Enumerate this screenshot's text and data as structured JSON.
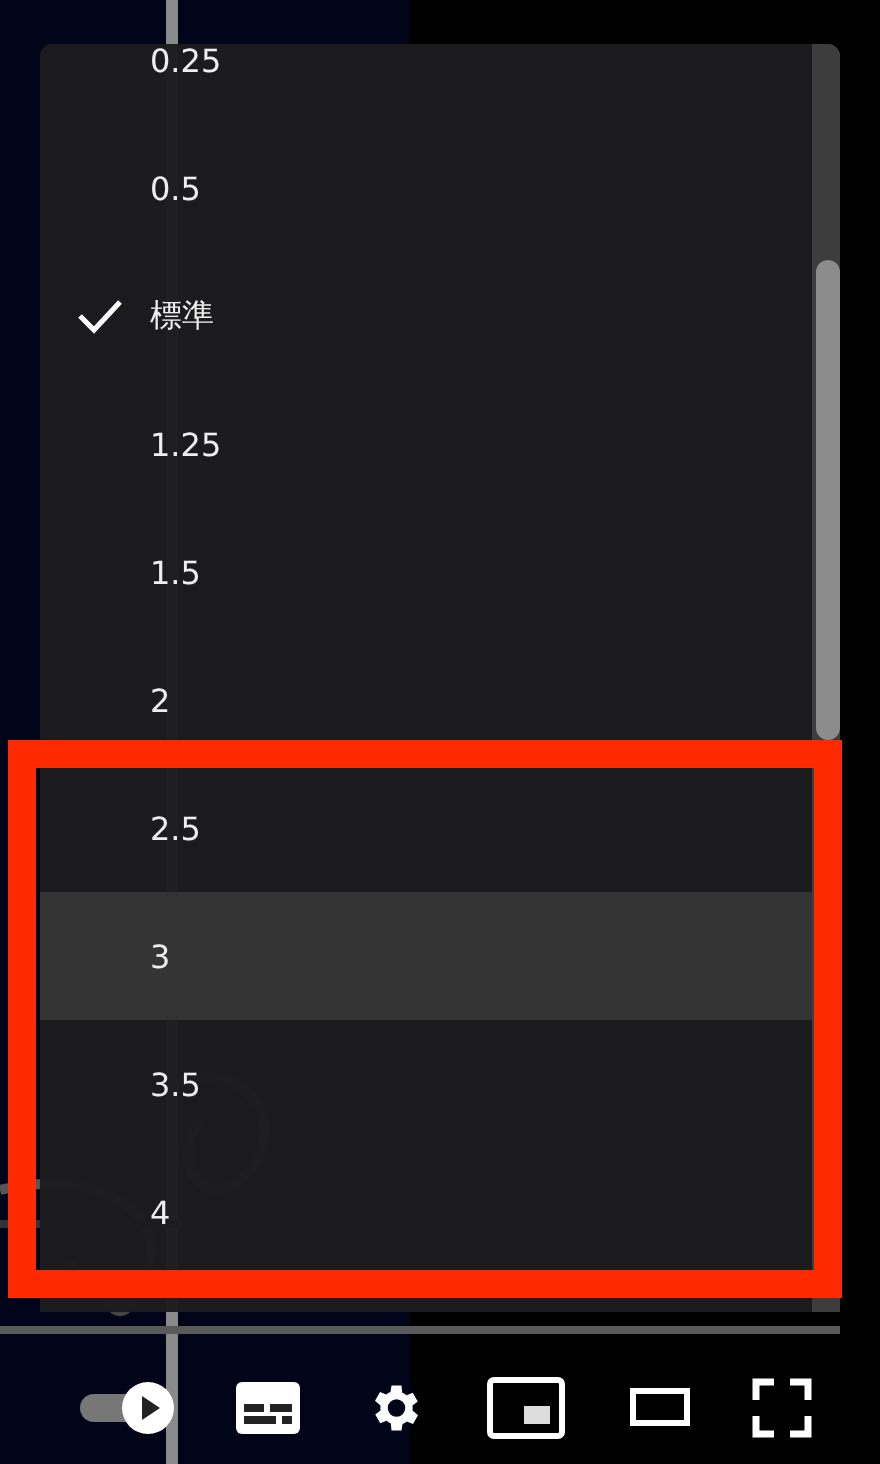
{
  "speed_menu": {
    "items": [
      {
        "label": "0.25",
        "selected": false,
        "hovered": false
      },
      {
        "label": "0.5",
        "selected": false,
        "hovered": false
      },
      {
        "label": "標準",
        "selected": true,
        "hovered": false
      },
      {
        "label": "1.25",
        "selected": false,
        "hovered": false
      },
      {
        "label": "1.5",
        "selected": false,
        "hovered": false
      },
      {
        "label": "2",
        "selected": false,
        "hovered": false
      },
      {
        "label": "2.5",
        "selected": false,
        "hovered": false
      },
      {
        "label": "3",
        "selected": false,
        "hovered": true
      },
      {
        "label": "3.5",
        "selected": false,
        "hovered": false
      },
      {
        "label": "4",
        "selected": false,
        "hovered": false
      }
    ]
  },
  "player_controls": {
    "autoplay": {
      "on": true
    }
  }
}
